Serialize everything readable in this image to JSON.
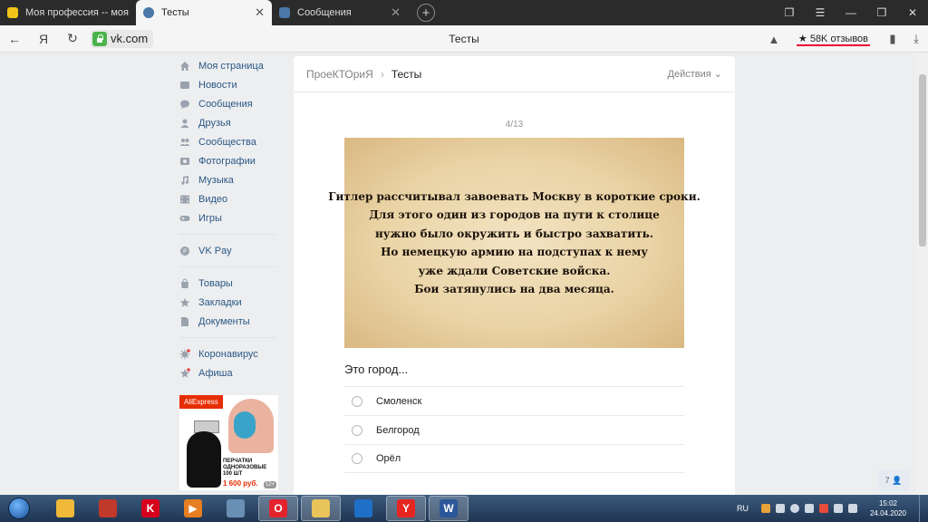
{
  "browser": {
    "tabs": [
      {
        "title": "Моя профессия -- моя ис",
        "active": false,
        "favicon_color": "#f0c419"
      },
      {
        "title": "Тесты",
        "active": true,
        "favicon_color": "#4a76a8"
      },
      {
        "title": "Сообщения",
        "active": false,
        "favicon_color": "#4a76a8"
      }
    ],
    "new_tab_symbol": "+",
    "address": {
      "domain": "vk.com",
      "page_title": "Тесты",
      "reviews_badge": "★ 58K отзывов",
      "brand_glyph": "Я"
    }
  },
  "left_menu": {
    "groups": [
      [
        {
          "label": "Моя страница",
          "icon": "home-icon"
        },
        {
          "label": "Новости",
          "icon": "news-icon"
        },
        {
          "label": "Сообщения",
          "icon": "messages-icon"
        },
        {
          "label": "Друзья",
          "icon": "friends-icon"
        },
        {
          "label": "Сообщества",
          "icon": "groups-icon"
        },
        {
          "label": "Фотографии",
          "icon": "photos-icon"
        },
        {
          "label": "Музыка",
          "icon": "music-icon"
        },
        {
          "label": "Видео",
          "icon": "video-icon"
        },
        {
          "label": "Игры",
          "icon": "games-icon"
        }
      ],
      [
        {
          "label": "VK Pay",
          "icon": "vkpay-icon"
        }
      ],
      [
        {
          "label": "Товары",
          "icon": "market-icon"
        },
        {
          "label": "Закладки",
          "icon": "bookmarks-icon"
        },
        {
          "label": "Документы",
          "icon": "documents-icon"
        }
      ],
      [
        {
          "label": "Коронавирус",
          "icon": "coronavirus-icon"
        },
        {
          "label": "Афиша",
          "icon": "afisha-icon"
        }
      ]
    ],
    "ad": {
      "brand": "AliExpress",
      "text_line1": "ПЕРЧАТКИ",
      "text_line2": "ОДНОРАЗОВЫЕ",
      "text_line3": "100 ШТ",
      "price": "1 600 руб.",
      "age": "12+"
    }
  },
  "card": {
    "breadcrumb_parent": "ПроеКТОриЯ",
    "breadcrumb_current": "Тесты",
    "actions_label": "Действия",
    "counter": "4/13",
    "image_text_lines": [
      "Гитлер рассчитывал завоевать Москву в короткие сроки.",
      "Для этого один из городов на пути к столице",
      "нужно было окружить и быстро захватить.",
      "Но немецкую армию на подступах к нему",
      "уже ждали Советские войска.",
      "Бои затянулись на два месяца."
    ],
    "question": "Это город...",
    "options": [
      "Смоленск",
      "Белгород",
      "Орёл"
    ]
  },
  "chat_badge": "7",
  "taskbar": {
    "apps": [
      {
        "name": "explorer-icon",
        "color": "#f0b93a",
        "glyph": "",
        "active": false
      },
      {
        "name": "archive-icon",
        "color": "#c0392b",
        "glyph": "",
        "active": false
      },
      {
        "name": "kaspersky-icon",
        "color": "#d6001c",
        "glyph": "K",
        "active": false
      },
      {
        "name": "media-player-icon",
        "color": "#e67e22",
        "glyph": "▶",
        "active": false
      },
      {
        "name": "network-icon",
        "color": "#6a8fb5",
        "glyph": "",
        "active": false
      },
      {
        "name": "opera-icon",
        "color": "#e3232c",
        "glyph": "O",
        "active": true
      },
      {
        "name": "folder-icon",
        "color": "#e8c35a",
        "glyph": "",
        "active": true
      },
      {
        "name": "messenger-icon",
        "color": "#1f6fc6",
        "glyph": "",
        "active": false
      },
      {
        "name": "yandex-browser-icon",
        "color": "#e52620",
        "glyph": "Y",
        "active": true
      },
      {
        "name": "word-icon",
        "color": "#2b579a",
        "glyph": "W",
        "active": true
      }
    ],
    "lang": "RU",
    "time": "15:02",
    "date": "24.04.2020"
  },
  "colors": {
    "vk_link": "#2a5885",
    "vk_bg": "#edeef0"
  }
}
